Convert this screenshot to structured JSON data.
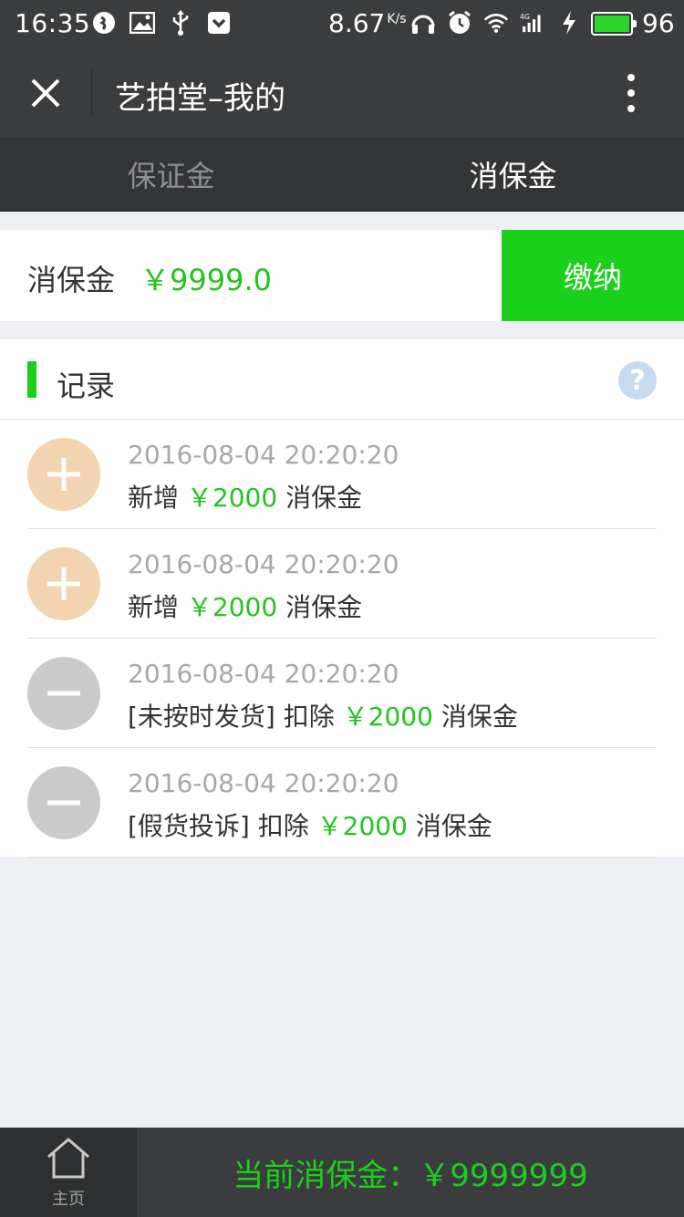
{
  "status_bar": {
    "time": "16:35",
    "net_speed": "8.67",
    "net_speed_unit": "K/s",
    "battery": "96",
    "battery_color": "#2bd428"
  },
  "title_bar": {
    "title": "艺拍堂–我的",
    "close_icon": "close-icon",
    "more_icon": "more-vertical-icon"
  },
  "tabs": [
    {
      "label": "保证金",
      "active": false
    },
    {
      "label": "消保金",
      "active": true
    }
  ],
  "deposit": {
    "label": "消保金",
    "amount": "￥9999.0",
    "pay_button": "缴纳"
  },
  "records": {
    "title": "记录",
    "help_icon": "?",
    "items": [
      {
        "type": "plus",
        "time": "2016-08-04 20:20:20",
        "prefix": "新增 ",
        "amount": "￥2000",
        "suffix": " 消保金"
      },
      {
        "type": "plus",
        "time": "2016-08-04 20:20:20",
        "prefix": "新增 ",
        "amount": "￥2000",
        "suffix": " 消保金"
      },
      {
        "type": "minus",
        "time": "2016-08-04 20:20:20",
        "prefix": "[未按时发货] 扣除 ",
        "amount": "￥2000",
        "suffix": " 消保金"
      },
      {
        "type": "minus",
        "time": "2016-08-04 20:20:20",
        "prefix": "[假货投诉] 扣除 ",
        "amount": "￥2000",
        "suffix": " 消保金"
      }
    ]
  },
  "bottom_bar": {
    "home_label": "主页",
    "current_total": "当前消保金：￥9999999"
  },
  "colors": {
    "accent_green": "#1bd01b",
    "amount_green": "#22c41d",
    "plus_bg": "#f3d4b0",
    "minus_bg": "#cbcbcb",
    "dark_bar": "#3b3c3e"
  }
}
